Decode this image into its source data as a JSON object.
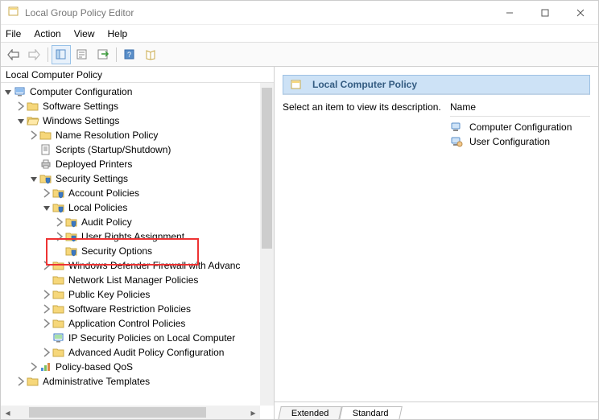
{
  "window": {
    "title": "Local Group Policy Editor"
  },
  "menu": {
    "file": "File",
    "action": "Action",
    "view": "View",
    "help": "Help"
  },
  "tree": {
    "header": "Local Computer Policy",
    "root_name": "Computer Configuration",
    "items": {
      "software_settings": "Software Settings",
      "windows_settings": "Windows Settings",
      "name_resolution": "Name Resolution Policy",
      "scripts": "Scripts (Startup/Shutdown)",
      "deployed_printers": "Deployed Printers",
      "security_settings": "Security Settings",
      "account_policies": "Account Policies",
      "local_policies": "Local Policies",
      "audit_policy": "Audit Policy",
      "user_rights": "User Rights Assignment",
      "security_options": "Security Options",
      "wdf": "Windows Defender Firewall with Advanc",
      "nlmp": "Network List Manager Policies",
      "pkp": "Public Key Policies",
      "srp": "Software Restriction Policies",
      "acp": "Application Control Policies",
      "ipsec": "IP Security Policies on Local Computer",
      "aapc": "Advanced Audit Policy Configuration",
      "pbqos": "Policy-based QoS",
      "admin_templates": "Administrative Templates"
    }
  },
  "detail": {
    "title": "Local Computer Policy",
    "hint": "Select an item to view its description.",
    "col_name": "Name",
    "items": {
      "computer_config": "Computer Configuration",
      "user_config": "User Configuration"
    }
  },
  "tabs": {
    "extended": "Extended",
    "standard": "Standard"
  }
}
